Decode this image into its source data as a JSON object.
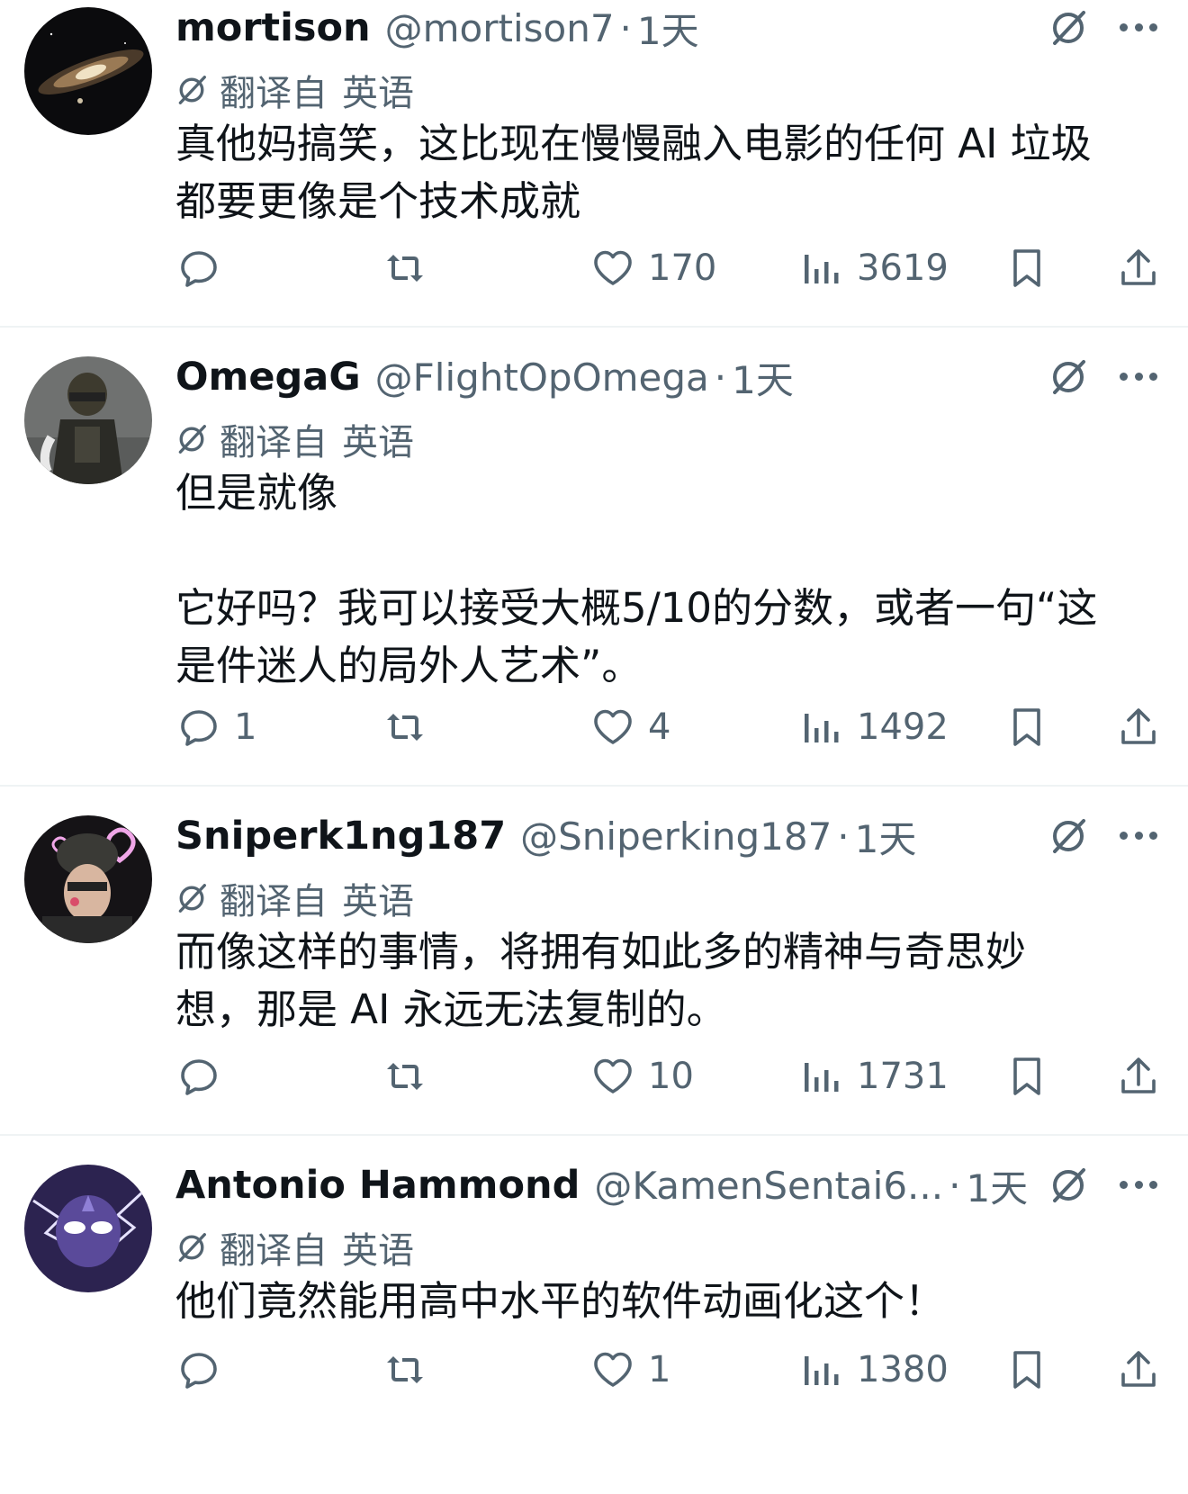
{
  "translation_label": "翻译自",
  "translation_lang": "英语",
  "tweets": [
    {
      "username": "mortison",
      "handle": "@mortison7",
      "time": "1天",
      "text": "真他妈搞笑，这比现在慢慢融入电影的任何 AI 垃圾\n都要更像是个技术成就",
      "replies": "",
      "likes": "170",
      "views": "3619",
      "avatar_icon": "galaxy-avatar"
    },
    {
      "username": "OmegaG",
      "handle": "@FlightOpOmega",
      "time": "1天",
      "text": "但是就像\n\n它好吗？我可以接受大概5/10的分数，或者一句“这\n是件迷人的局外人艺术”。",
      "replies": "1",
      "likes": "4",
      "views": "1492",
      "avatar_icon": "soldier-avatar"
    },
    {
      "username": "Sniperk1ng187",
      "handle": "@Sniperking187",
      "time": "1天",
      "text": "而像这样的事情，将拥有如此多的精神与奇思妙\n想，那是 AI 永远无法复制的。",
      "replies": "",
      "likes": "10",
      "views": "1731",
      "avatar_icon": "gamer-avatar"
    },
    {
      "username": "Antonio Hammond",
      "handle": "@KamenSentai6...",
      "time": "1天",
      "text": "他们竟然能用高中水平的软件动画化这个！",
      "replies": "",
      "likes": "1",
      "views": "1380",
      "avatar_icon": "lightning-mask-avatar"
    }
  ]
}
